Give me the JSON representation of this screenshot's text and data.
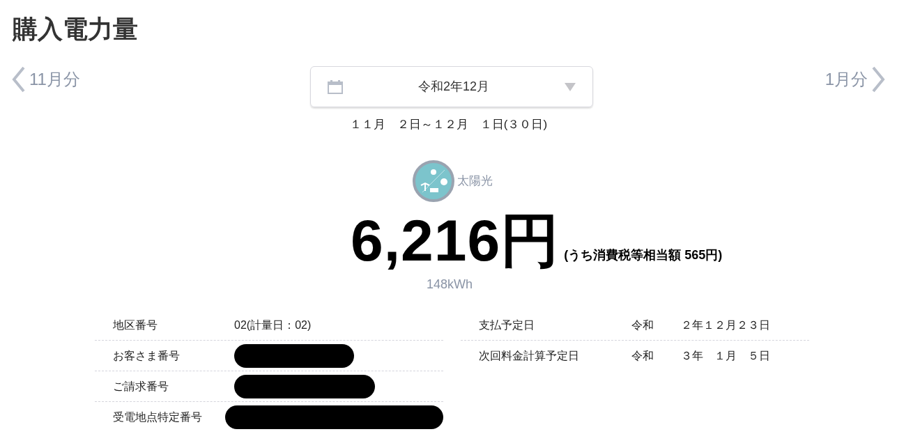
{
  "title": "購入電力量",
  "nav": {
    "prev": "11月分",
    "next": "1月分"
  },
  "month_select": {
    "value": "令和2年12月"
  },
  "period": "１１月　２日～１２月　１日(３０日)",
  "source": {
    "label": "太陽光"
  },
  "amount": {
    "total": "6,216円",
    "tax_note": "(うち消費税等相当額 565円)",
    "usage": "148kWh"
  },
  "left_table": [
    {
      "label": "地区番号",
      "value": "02(計量日：02)",
      "redacted": false
    },
    {
      "label": "お客さま番号",
      "redacted": true
    },
    {
      "label": "ご請求番号",
      "redacted": true
    },
    {
      "label": "受電地点特定番号",
      "redacted": true
    }
  ],
  "right_table": [
    {
      "label": "支払予定日",
      "era": "令和",
      "date": "２年１２月２３日"
    },
    {
      "label": "次回料金計算予定日",
      "era": "令和",
      "date": "３年　１月　５日"
    }
  ]
}
